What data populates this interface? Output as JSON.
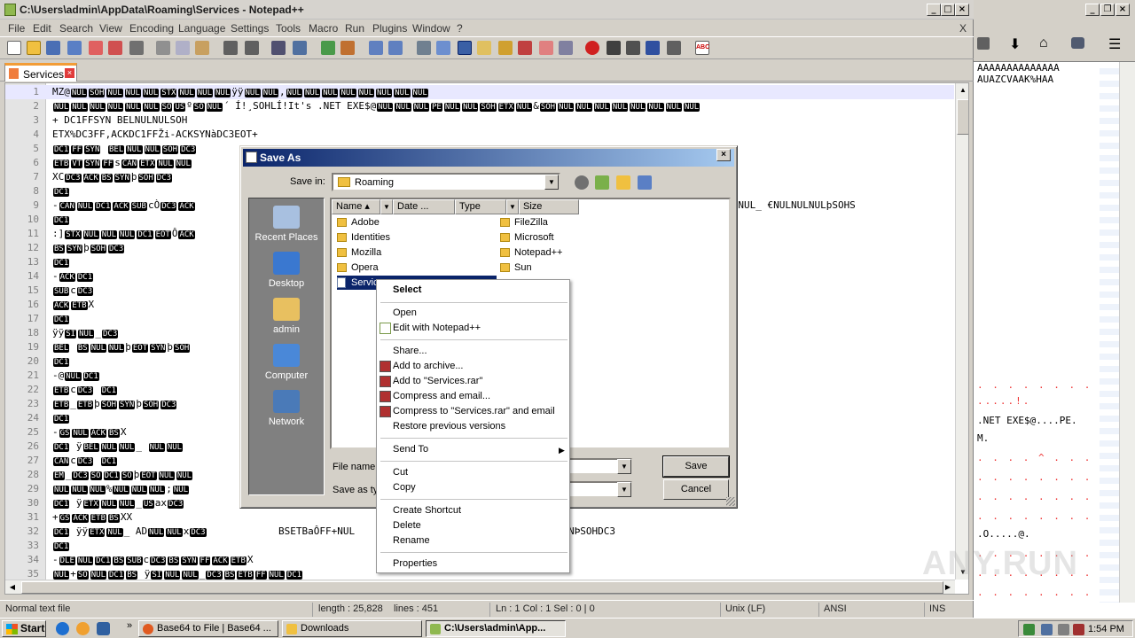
{
  "npp": {
    "title": "C:\\Users\\admin\\AppData\\Roaming\\Services - Notepad++",
    "menu": [
      "File",
      "Edit",
      "Search",
      "View",
      "Encoding",
      "Language",
      "Settings",
      "Tools",
      "Macro",
      "Run",
      "Plugins",
      "Window",
      "?"
    ],
    "menu_close": "X",
    "tab_label": "Services",
    "status": {
      "type": "Normal text file",
      "length": "length : 25,828",
      "lines": "lines : 451",
      "position": "Ln : 1    Col : 1    Sel : 0 | 0",
      "eol": "Unix (LF)",
      "encoding": "ANSI",
      "mode": "INS"
    }
  },
  "editor": {
    "line_numbers": [
      "1",
      "2",
      "3",
      "4",
      "5",
      "6",
      "7",
      "8",
      "9",
      "10",
      "11",
      "12",
      "13",
      "14",
      "15",
      "16",
      "17",
      "18",
      "19",
      "20",
      "21",
      "22",
      "23",
      "24",
      "25",
      "26",
      "27",
      "28",
      "29",
      "30",
      "31",
      "32",
      "33",
      "34",
      "35"
    ],
    "line_text": {
      "1_tail": "ÿÿ",
      "2_tail": "Í!¸SOHLÍ!It's .NET EXE$@",
      "3_tail": "+   DC1FFSYN  BELNULNULSOH",
      "4_tail": "ETX%DC3FF,ACKDC1FFŽi-ACKSYNàDC3EOT+",
      "9_right": "€NULNULNUL_  €NULNULNULþSOHS",
      "32_mid": "BSETBaÔFF+NUL",
      "32_right": "NÞSOHDC3"
    }
  },
  "dialog": {
    "title": "Save As",
    "save_in_label": "Save in:",
    "save_in_value": "Roaming",
    "places": [
      "Recent Places",
      "Desktop",
      "admin",
      "Computer",
      "Network"
    ],
    "columns": [
      "Name",
      "Date ...",
      "Type",
      "Size"
    ],
    "folders_left": [
      "Adobe",
      "Identities",
      "Mozilla",
      "Opera"
    ],
    "folders_right": [
      "FileZilla",
      "Microsoft",
      "Notepad++",
      "Sun"
    ],
    "selected_file": "Services",
    "file_name_label": "File name:",
    "save_type_label": "Save as ty",
    "save_button": "Save",
    "cancel_button": "Cancel"
  },
  "context_menu": {
    "items": [
      "Select",
      "Open",
      "Edit with Notepad++",
      "Share...",
      "Add to archive...",
      "Add to \"Services.rar\"",
      "Compress and email...",
      "Compress to \"Services.rar\" and email",
      "Restore previous versions",
      "Send To",
      "Cut",
      "Copy",
      "Create Shortcut",
      "Delete",
      "Rename",
      "Properties"
    ]
  },
  "right_window": {
    "row1": "AAAAAAAAAAAAAA",
    "row2": "AUAZCVAAK%HAA",
    "row_exe": ".NET EXE$@....PE.",
    "row_m": "M.",
    "row_o": ".O.....@.",
    "row_excl": ".....!.",
    "row_at": "@."
  },
  "taskbar": {
    "start": "Start",
    "items": [
      "Base64 to File | Base64 ...",
      "Downloads",
      "C:\\Users\\admin\\App..."
    ],
    "clock": "1:54 PM"
  },
  "watermark": "ANY.RUN",
  "colors": {
    "accent": "#0a246a",
    "tab_orange": "#f29c36",
    "selection": "#0a246a"
  }
}
